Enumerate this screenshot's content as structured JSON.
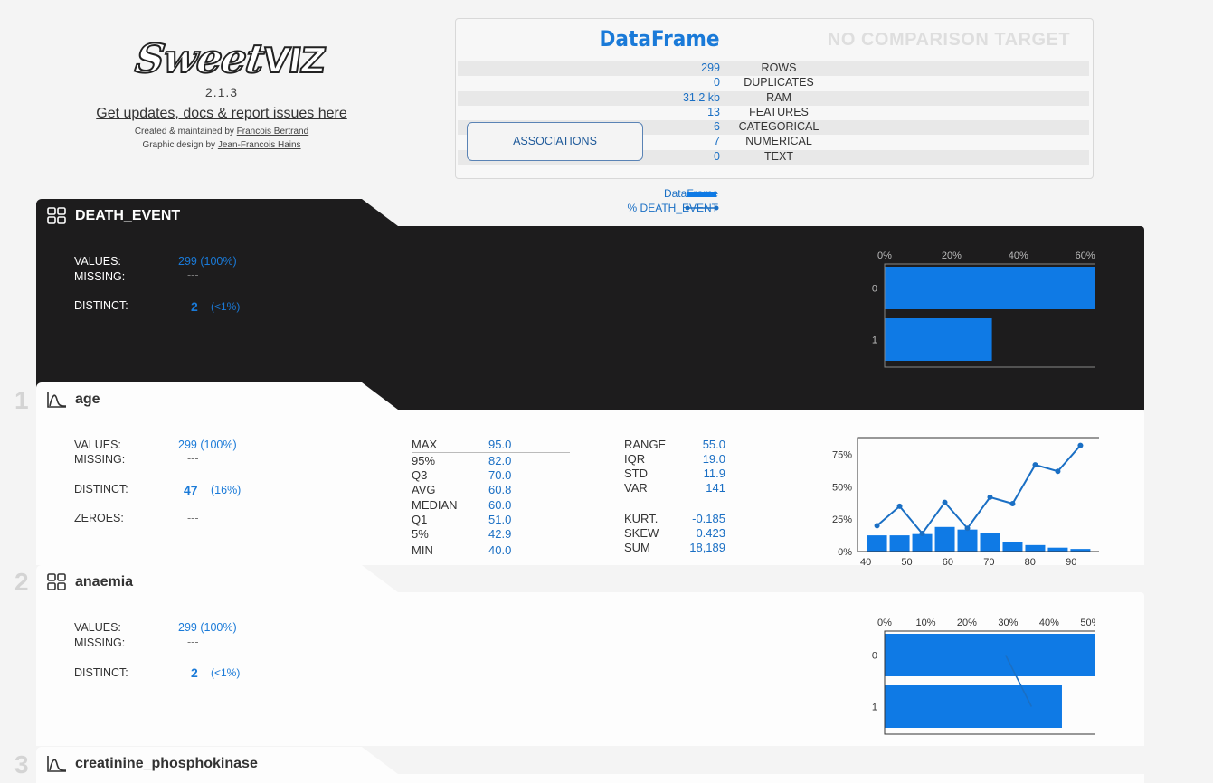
{
  "logo": {
    "brand_main": "Sweet",
    "brand_viz": "VIZ",
    "version": "2.1.3",
    "updates_link": "Get updates, docs & report issues here",
    "created_by_prefix": "Created & maintained by ",
    "created_by_name": "Francois Bertrand",
    "design_prefix": "Graphic design by ",
    "design_name": "Jean-Francois Hains"
  },
  "summary": {
    "title": "DataFrame",
    "no_comparison": "NO COMPARISON TARGET",
    "associations_button": "ASSOCIATIONS",
    "rows": [
      {
        "value": "299",
        "label": "ROWS"
      },
      {
        "value": "0",
        "label": "DUPLICATES"
      },
      {
        "value": "31.2 kb",
        "label": "RAM"
      },
      {
        "value": "13",
        "label": "FEATURES"
      },
      {
        "value": "6",
        "label": "CATEGORICAL"
      },
      {
        "value": "7",
        "label": "NUMERICAL"
      },
      {
        "value": "0",
        "label": "TEXT"
      }
    ]
  },
  "legend": {
    "dataframe": "DataFrame",
    "pct_target": "% DEATH_EVENT"
  },
  "features": [
    {
      "name": "DEATH_EVENT",
      "values_label": "VALUES:",
      "values": "299 (100%)",
      "missing_label": "MISSING:",
      "missing": "---",
      "distinct_label": "DISTINCT:",
      "distinct": "2",
      "distinct_pct": "(<1%)"
    },
    {
      "index": "1",
      "name": "age",
      "values_label": "VALUES:",
      "values": "299 (100%)",
      "missing_label": "MISSING:",
      "missing": "---",
      "distinct_label": "DISTINCT:",
      "distinct": "47",
      "distinct_pct": "(16%)",
      "zeroes_label": "ZEROES:",
      "zeroes": "---",
      "quantiles": [
        {
          "k": "MAX",
          "v": "95.0"
        },
        {
          "k": "95%",
          "v": "82.0"
        },
        {
          "k": "Q3",
          "v": "70.0"
        },
        {
          "k": "AVG",
          "v": "60.8"
        },
        {
          "k": "MEDIAN",
          "v": "60.0"
        },
        {
          "k": "Q1",
          "v": "51.0"
        },
        {
          "k": "5%",
          "v": "42.9"
        },
        {
          "k": "MIN",
          "v": "40.0"
        }
      ],
      "stats": [
        {
          "k": "RANGE",
          "v": "55.0"
        },
        {
          "k": "IQR",
          "v": "19.0"
        },
        {
          "k": "STD",
          "v": "11.9"
        },
        {
          "k": "VAR",
          "v": "141"
        },
        {
          "k": "KURT.",
          "v": "-0.185"
        },
        {
          "k": "SKEW",
          "v": "0.423"
        },
        {
          "k": "SUM",
          "v": "18,189"
        }
      ]
    },
    {
      "index": "2",
      "name": "anaemia",
      "values_label": "VALUES:",
      "values": "299 (100%)",
      "missing_label": "MISSING:",
      "missing": "---",
      "distinct_label": "DISTINCT:",
      "distinct": "2",
      "distinct_pct": "(<1%)"
    },
    {
      "index": "3",
      "name": "creatinine_phosphokinase"
    }
  ],
  "colors": {
    "accent": "#1a7ad8",
    "bar": "#0f7ae5",
    "dark_card": "#1d1c1d",
    "light_card": "#fdfdfd"
  },
  "chart_data": [
    {
      "type": "bar",
      "orientation": "horizontal",
      "feature": "DEATH_EVENT",
      "categories": [
        "0",
        "1"
      ],
      "values": [
        67.9,
        32.1
      ],
      "xticks": [
        "0%",
        "20%",
        "40%",
        "60%"
      ],
      "xlim": [
        0,
        72
      ]
    },
    {
      "type": "bar",
      "feature": "age",
      "series": [
        {
          "name": "DataFrame",
          "x": [
            42.75,
            48.25,
            53.75,
            59.25,
            64.75,
            70.25,
            75.75,
            81.25,
            86.75,
            92.25
          ],
          "values": [
            12.5,
            12.5,
            13.5,
            19,
            17,
            14,
            7,
            5,
            3,
            2
          ]
        },
        {
          "name": "% DEATH_EVENT",
          "x": [
            42.75,
            48.25,
            53.75,
            59.25,
            64.75,
            70.25,
            75.75,
            81.25,
            86.75,
            92.25
          ],
          "values": [
            20,
            35,
            14,
            38,
            18,
            42,
            37,
            67,
            62,
            82
          ]
        }
      ],
      "xticks": [
        "40",
        "50",
        "60",
        "70",
        "80",
        "90"
      ],
      "yticks": [
        "0%",
        "25%",
        "50%",
        "75%"
      ],
      "xlim": [
        38,
        97
      ],
      "ylim": [
        0,
        88
      ]
    },
    {
      "type": "bar",
      "orientation": "horizontal",
      "feature": "anaemia",
      "categories": [
        "0",
        "1"
      ],
      "values": [
        56.9,
        43.1
      ],
      "target_pct": [
        29.4,
        35.7
      ],
      "xticks": [
        "0%",
        "10%",
        "20%",
        "30%",
        "40%",
        "50%"
      ],
      "xlim": [
        0,
        58.5
      ]
    }
  ]
}
